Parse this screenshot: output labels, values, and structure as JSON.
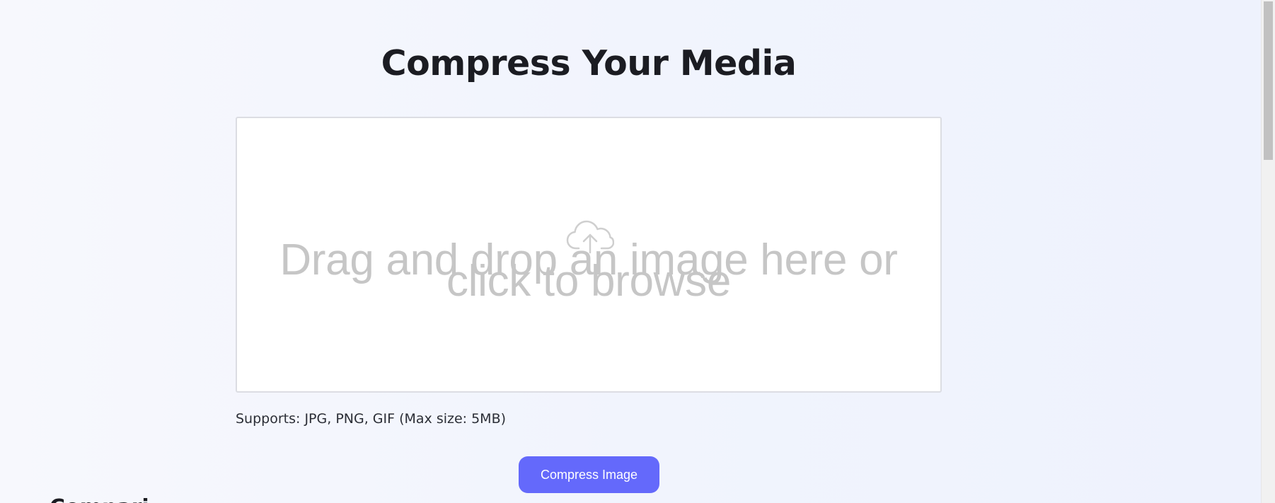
{
  "page": {
    "title": "Compress Your Media",
    "next_section_heading": "Compari"
  },
  "dropzone": {
    "icon": "cloud-upload-icon",
    "text": "Drag and drop an image here or click to browse"
  },
  "supports_text": "Supports: JPG, PNG, GIF (Max size: 5MB)",
  "actions": {
    "compress_label": "Compress Image"
  },
  "colors": {
    "accent": "#6469fb",
    "dropzone_text": "#c6c6c6",
    "background": "#f1f4fd"
  }
}
